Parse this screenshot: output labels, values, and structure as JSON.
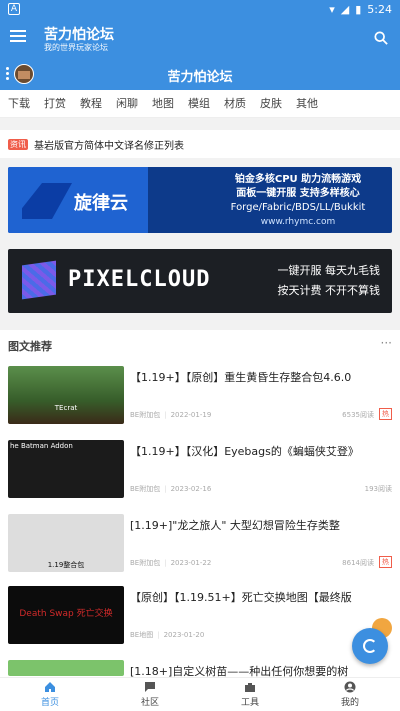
{
  "status": {
    "left_badge": "A",
    "time": "5:24"
  },
  "appbar": {
    "title": "苦力怕论坛",
    "subtitle": "我的世界玩家论坛"
  },
  "headerbar": {
    "title": "苦力怕论坛"
  },
  "categories": [
    "下载",
    "打赏",
    "教程",
    "闲聊",
    "地图",
    "模组",
    "材质",
    "皮肤",
    "其他"
  ],
  "notice": {
    "tag": "资讯",
    "text": "基岩版官方简体中文译名修正列表"
  },
  "banner1": {
    "brand": "旋律云",
    "line1": "铂金多核CPU  助力流畅游戏",
    "line2": "面板一键开服  支持多样核心",
    "line3": "Forge/Fabric/BDS/LL/Bukkit",
    "domain": "www.rhymc.com"
  },
  "banner2": {
    "brand": "PIXELCLOUD",
    "slogan_top": "一键开服  每天九毛钱",
    "slogan_bottom": "按天计费  不开不算钱"
  },
  "section": {
    "title": "图文推荐",
    "more": "···"
  },
  "posts": [
    {
      "title": "【1.19+】【原创】重生黄昏生存整合包4.6.0",
      "source": "BE附加包",
      "date": "2022-01-19",
      "views": "6535阅读",
      "hot": "热",
      "thumb_label": "TEcrat"
    },
    {
      "title": "【1.19+】【汉化】Eyebags的《蝙蝠侠艾登》",
      "source": "BE附加包",
      "date": "2023-02-16",
      "views": "193阅读",
      "hot": "",
      "thumb_label": "he Batman Addon"
    },
    {
      "title": "[1.19+]\"龙之旅人\" 大型幻想冒险生存类整",
      "source": "BE附加包",
      "date": "2023-01-22",
      "views": "8614阅读",
      "hot": "热",
      "thumb_label": "1.19整合包"
    },
    {
      "title": "【原创】【1.19.51+】死亡交换地图【最终版",
      "source": "BE地图",
      "date": "2023-01-20",
      "views": "",
      "hot": "",
      "thumb_label": "Death Swap 死亡交换"
    },
    {
      "title": "[1.18+]自定义树苗——种出任何你想要的树",
      "source": "",
      "date": "",
      "views": "",
      "hot": "",
      "thumb_label": ""
    }
  ],
  "bottomnav": [
    "首页",
    "社区",
    "工具",
    "我的"
  ]
}
